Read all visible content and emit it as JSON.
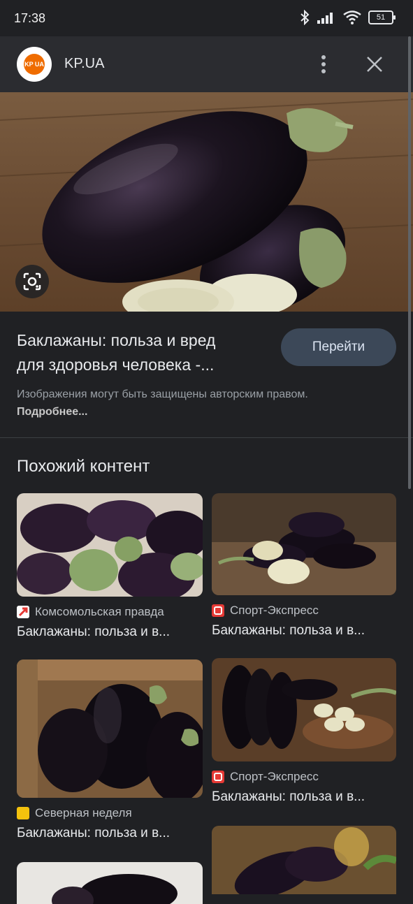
{
  "status": {
    "time": "17:38",
    "battery": "51"
  },
  "site": {
    "name": "KP.UA",
    "logo_text": "KP UA"
  },
  "result": {
    "title_line1": "Баклажаны: польза и вред",
    "title_line2": "для здоровья человека -...",
    "go_button": "Перейти",
    "copyright": "Изображения могут быть защищены авторским правом.",
    "more_link": "Подробнее..."
  },
  "similar": {
    "heading": "Похожий контент",
    "items": [
      {
        "source": "Комсомольская правда",
        "title": "Баклажаны: польза и в..."
      },
      {
        "source": "Спорт-Экспресс",
        "title": "Баклажаны: польза и в..."
      },
      {
        "source": "Северная неделя",
        "title": "Баклажаны: польза и в..."
      },
      {
        "source": "Спорт-Экспресс",
        "title": "Баклажаны: польза и в..."
      }
    ]
  },
  "colors": {
    "background": "#202124",
    "button": "#3c4858",
    "accent_logo": "#ef6c00"
  }
}
